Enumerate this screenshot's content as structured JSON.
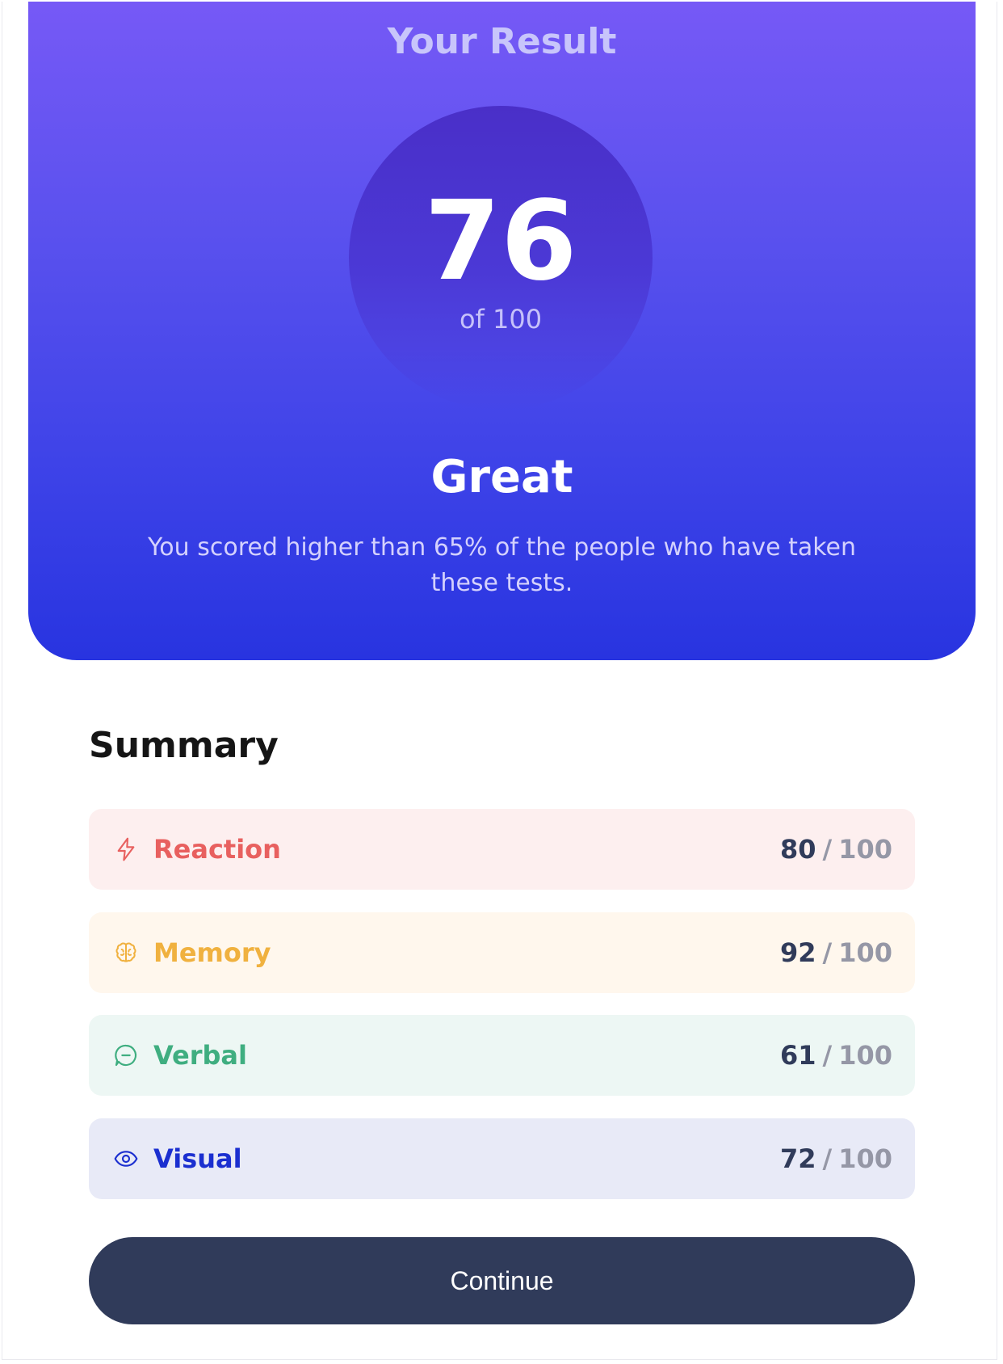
{
  "result": {
    "title": "Your Result",
    "score": "76",
    "score_total": "of 100",
    "rating": "Great",
    "description": "You scored higher than 65% of the people who have taken these tests."
  },
  "summary": {
    "title": "Summary",
    "items": [
      {
        "label": "Reaction",
        "score": "80",
        "separator": "/",
        "max": "100",
        "icon": "lightning-icon",
        "color": "#e8605f",
        "background": "#fdefef"
      },
      {
        "label": "Memory",
        "score": "92",
        "separator": "/",
        "max": "100",
        "icon": "brain-icon",
        "color": "#f0b13f",
        "background": "#fff7ed"
      },
      {
        "label": "Verbal",
        "score": "61",
        "separator": "/",
        "max": "100",
        "icon": "chat-bubble-icon",
        "color": "#3fae80",
        "background": "#edf7f4"
      },
      {
        "label": "Visual",
        "score": "72",
        "separator": "/",
        "max": "100",
        "icon": "eye-icon",
        "color": "#1b2fd0",
        "background": "#e8eaf7"
      }
    ]
  },
  "actions": {
    "continue_label": "Continue"
  },
  "colors": {
    "gradient_top": "#7659f6",
    "gradient_bottom": "#2834e0",
    "button": "#303b5a"
  }
}
